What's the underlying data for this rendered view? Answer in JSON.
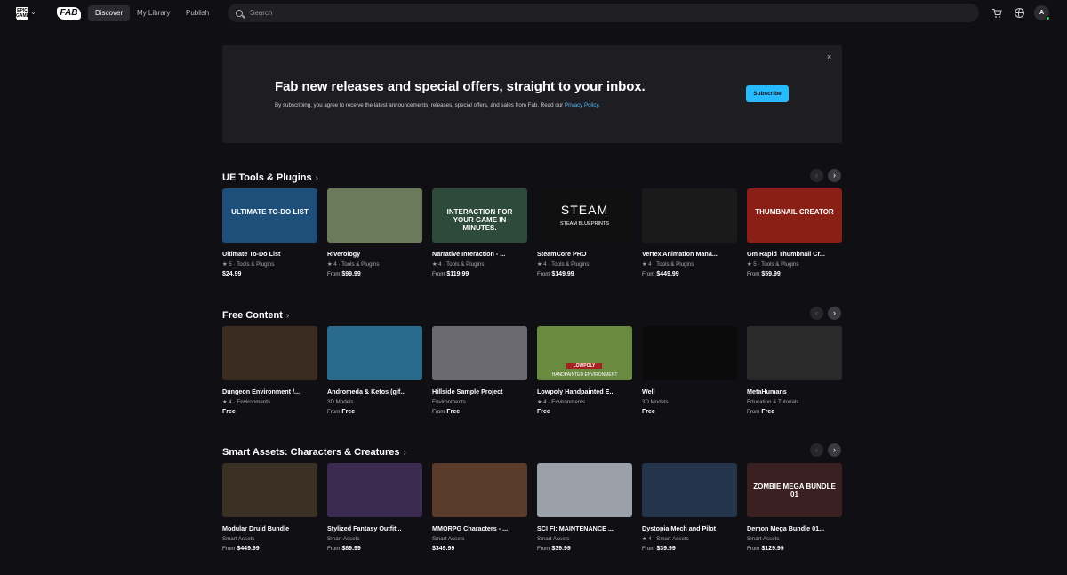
{
  "nav": {
    "epic_logo": "EPIC GAMES",
    "fab_logo": "FAB",
    "tabs": [
      {
        "label": "Discover"
      },
      {
        "label": "My Library"
      },
      {
        "label": "Publish"
      }
    ],
    "search_placeholder": "Search",
    "avatar_initial": "A"
  },
  "banner": {
    "title": "Fab new releases and special offers, straight to your inbox.",
    "text": "By subscribing, you agree to receive the latest announcements, releases, special offers, and sales from Fab. Read our",
    "link": "Privacy Policy",
    "text_end": ".",
    "subscribe_label": "Subscribe",
    "close_glyph": "×"
  },
  "sections": [
    {
      "title": "UE Tools & Plugins",
      "cards": [
        {
          "title": "Ultimate To-Do List",
          "rating": "5",
          "category": "Tools & Plugins",
          "from": "",
          "price": "$24.99",
          "thumb_text": "ULTIMATE TO-DO LIST"
        },
        {
          "title": "Riverology",
          "rating": "4",
          "category": "Tools & Plugins",
          "from": "From",
          "price": "$99.99",
          "thumb_text": ""
        },
        {
          "title": "Narrative Interaction - ...",
          "rating": "4",
          "category": "Tools & Plugins",
          "from": "From",
          "price": "$119.99",
          "thumb_text": "INTERACTION FOR YOUR GAME IN MINUTES."
        },
        {
          "title": "SteamCore PRO",
          "rating": "4",
          "category": "Tools & Plugins",
          "from": "From",
          "price": "$149.99",
          "thumb_text": "STEAM",
          "thumb_sub": "STEAM BLUEPRINTS"
        },
        {
          "title": "Vertex Animation Mana...",
          "rating": "4",
          "category": "Tools & Plugins",
          "from": "From",
          "price": "$449.99",
          "thumb_text": ""
        },
        {
          "title": "Gm Rapid Thumbnail Cr...",
          "rating": "5",
          "category": "Tools & Plugins",
          "from": "From",
          "price": "$59.99",
          "thumb_text": "THUMBNAIL CREATOR"
        }
      ]
    },
    {
      "title": "Free Content",
      "cards": [
        {
          "title": "Dungeon Environment /...",
          "rating": "4",
          "category": "Environments",
          "from": "",
          "price": "Free",
          "thumb_text": ""
        },
        {
          "title": "Andromeda & Ketos (gif...",
          "rating": "",
          "category": "3D Models",
          "from": "From",
          "price": "Free",
          "thumb_text": ""
        },
        {
          "title": "Hillside Sample Project",
          "rating": "",
          "category": "Environments",
          "from": "From",
          "price": "Free",
          "thumb_text": ""
        },
        {
          "title": "Lowpoly Handpainted E...",
          "rating": "4",
          "category": "Environments",
          "from": "",
          "price": "Free",
          "thumb_text": "LOWPOLY",
          "thumb_sub": "HANDPAINTED ENVIRONMENT"
        },
        {
          "title": "Well",
          "rating": "",
          "category": "3D Models",
          "from": "",
          "price": "Free",
          "thumb_text": ""
        },
        {
          "title": "MetaHumans",
          "rating": "",
          "category": "Education & Tutorials",
          "from": "From",
          "price": "Free",
          "thumb_text": ""
        }
      ]
    },
    {
      "title": "Smart Assets: Characters & Creatures",
      "cards": [
        {
          "title": "Modular Druid Bundle",
          "rating": "",
          "category": "Smart Assets",
          "from": "From",
          "price": "$449.99",
          "thumb_text": ""
        },
        {
          "title": "Stylized Fantasy Outfit...",
          "rating": "",
          "category": "Smart Assets",
          "from": "From",
          "price": "$89.99",
          "thumb_text": ""
        },
        {
          "title": "MMORPG Characters - ...",
          "rating": "",
          "category": "Smart Assets",
          "from": "",
          "price": "$349.99",
          "thumb_text": ""
        },
        {
          "title": "SCI FI: MAINTENANCE ...",
          "rating": "",
          "category": "Smart Assets",
          "from": "From",
          "price": "$39.99",
          "thumb_text": ""
        },
        {
          "title": "Dystopia Mech and Pilot",
          "rating": "4",
          "category": "Smart Assets",
          "from": "From",
          "price": "$39.99",
          "thumb_text": ""
        },
        {
          "title": "Demon Mega Bundle 01...",
          "rating": "",
          "category": "Smart Assets",
          "from": "From",
          "price": "$129.99",
          "thumb_text": "ZOMBIE MEGA BUNDLE 01"
        }
      ]
    }
  ],
  "colors": {
    "background": "#101014",
    "accent": "#26bbff",
    "card_backgrounds": [
      [
        "#1d4f7a",
        "#6b7a5a",
        "#2d4a3a",
        "#101010",
        "#1a1a1a",
        "#8a2015"
      ],
      [
        "#3a2c20",
        "#2a6a8a",
        "#6a6a70",
        "#6a8a40",
        "#0b0b0b",
        "#2a2a2a"
      ],
      [
        "#3a3024",
        "#3a2a50",
        "#5a3a2a",
        "#9aa0a8",
        "#24344a",
        "#3a2020"
      ]
    ]
  }
}
